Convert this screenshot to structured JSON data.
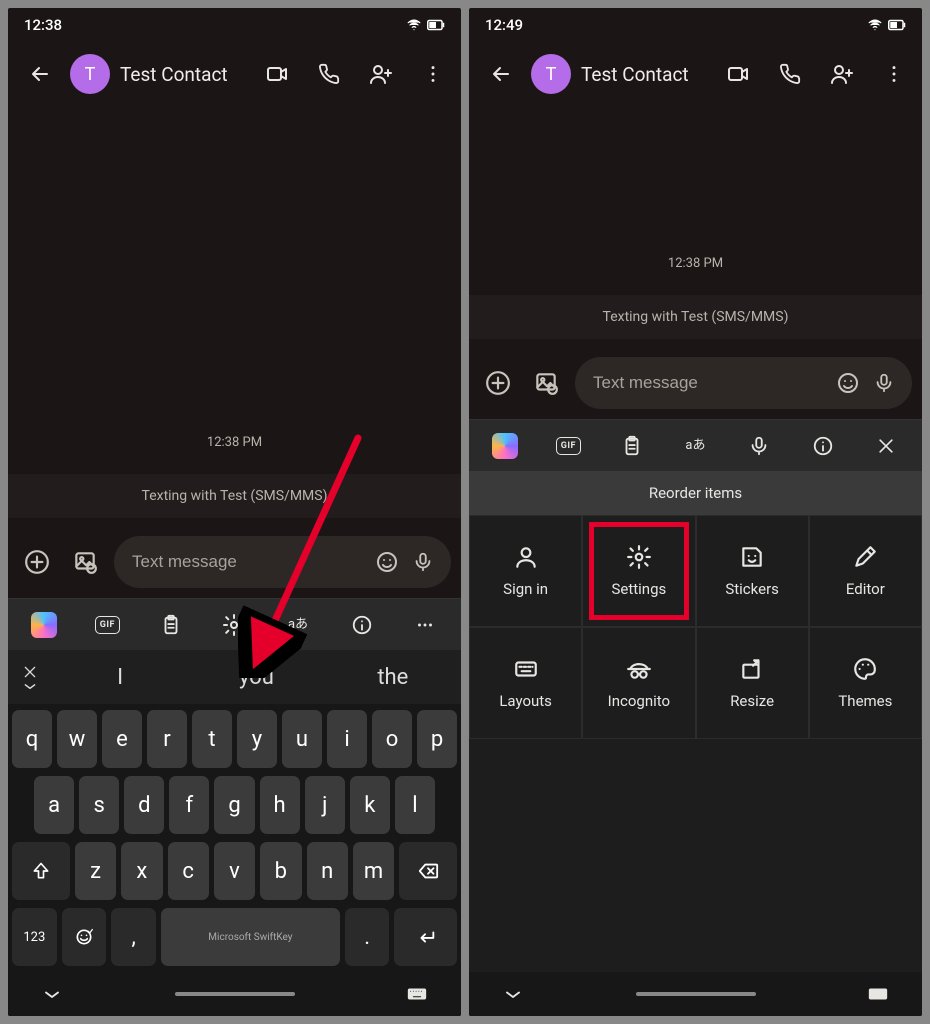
{
  "left": {
    "status_time": "12:38",
    "contact_initial": "T",
    "contact_name": "Test Contact",
    "conv_time": "12:38 PM",
    "info_banner": "Texting with Test (SMS/MMS)",
    "compose_placeholder": "Text message",
    "kb_brand": "Microsoft SwiftKey",
    "suggest": {
      "w1": "I",
      "w2": "you",
      "w3": "the"
    },
    "keys_r1": [
      "q",
      "w",
      "e",
      "r",
      "t",
      "y",
      "u",
      "i",
      "o",
      "p"
    ],
    "keys_r2": [
      "a",
      "s",
      "d",
      "f",
      "g",
      "h",
      "j",
      "k",
      "l"
    ],
    "keys_r3": [
      "z",
      "x",
      "c",
      "v",
      "b",
      "n",
      "m"
    ],
    "key_123": "123",
    "key_comma": ",",
    "key_period": ".",
    "translate_label": "aあ",
    "gif_label": "GIF"
  },
  "right": {
    "status_time": "12:49",
    "contact_initial": "T",
    "contact_name": "Test Contact",
    "conv_time": "12:38 PM",
    "info_banner": "Texting with Test (SMS/MMS)",
    "compose_placeholder": "Text message",
    "reorder_title": "Reorder items",
    "translate_label": "aあ",
    "gif_label": "GIF",
    "grid": [
      {
        "id": "signin",
        "label": "Sign in"
      },
      {
        "id": "settings",
        "label": "Settings",
        "highlight": true
      },
      {
        "id": "stickers",
        "label": "Stickers"
      },
      {
        "id": "editor",
        "label": "Editor"
      },
      {
        "id": "layouts",
        "label": "Layouts"
      },
      {
        "id": "incognito",
        "label": "Incognito"
      },
      {
        "id": "resize",
        "label": "Resize"
      },
      {
        "id": "themes",
        "label": "Themes"
      }
    ]
  }
}
